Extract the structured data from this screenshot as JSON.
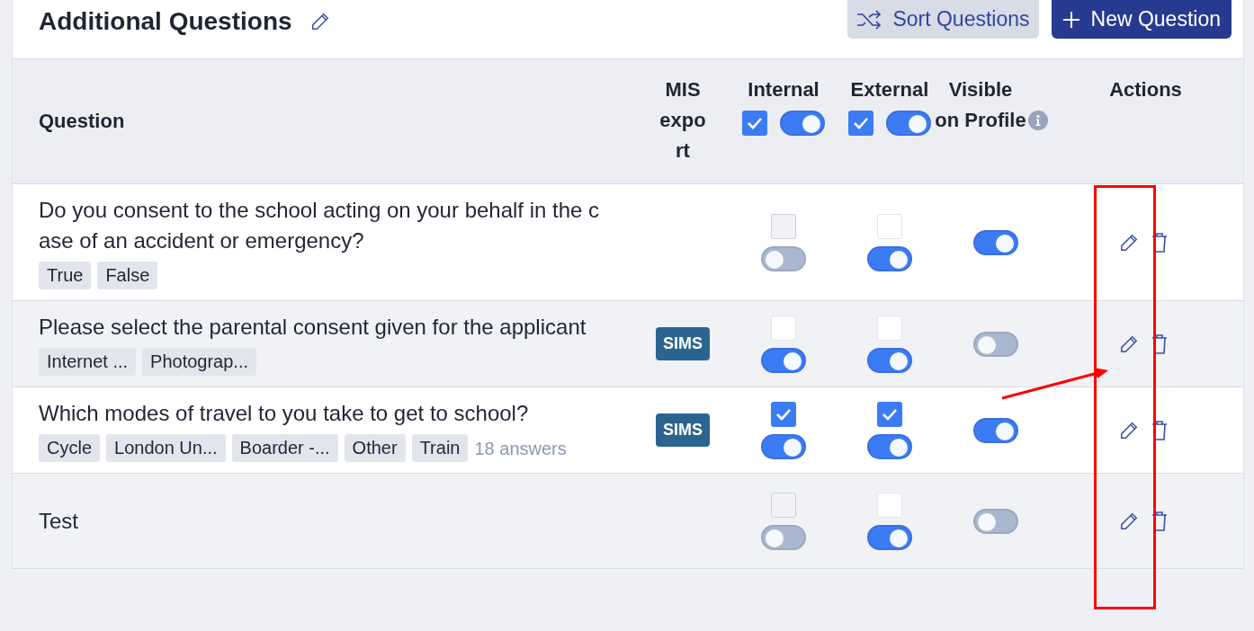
{
  "header": {
    "title": "Additional Questions",
    "buttons": [
      {
        "label": "Sort Questions",
        "kind": "secondary"
      },
      {
        "label": "New Question",
        "kind": "primary"
      }
    ]
  },
  "table": {
    "columns": [
      "Question",
      "MIS export",
      "Internal",
      "External",
      "Visible on Profile",
      "Actions"
    ],
    "internal_all": {
      "checked": true,
      "on": true
    },
    "external_all": {
      "checked": true,
      "on": true
    },
    "rows": [
      {
        "question": "Do you consent to the school acting on your behalf in the case of an accident or emergency?",
        "tags": [
          "True",
          "False"
        ],
        "internal": {
          "checked": false,
          "disabled": true,
          "on": false
        },
        "external": {
          "checked": false,
          "disabled": false,
          "on": true
        },
        "visible_on_profile": true
      },
      {
        "question": "Please select the parental consent given for the applicant",
        "tags": [
          "Internet ...",
          "Photograp..."
        ],
        "mis_export": "SIMS",
        "internal": {
          "checked": false,
          "disabled": false,
          "on": true
        },
        "external": {
          "checked": false,
          "disabled": false,
          "on": true
        },
        "visible_on_profile": false
      },
      {
        "question": "Which modes of travel to you take to get to school?",
        "tags": [
          "Cycle",
          "London Un...",
          "Boarder -...",
          "Other",
          "Train"
        ],
        "answers": "18 answers",
        "mis_export": "SIMS",
        "internal": {
          "checked": true,
          "on": true
        },
        "external": {
          "checked": true,
          "on": true
        },
        "visible_on_profile": true
      },
      {
        "question": "Test",
        "tags": [],
        "internal": {
          "checked": false,
          "disabled": true,
          "on": false
        },
        "external": {
          "checked": false,
          "disabled": false,
          "on": true
        },
        "visible_on_profile": false
      }
    ]
  }
}
